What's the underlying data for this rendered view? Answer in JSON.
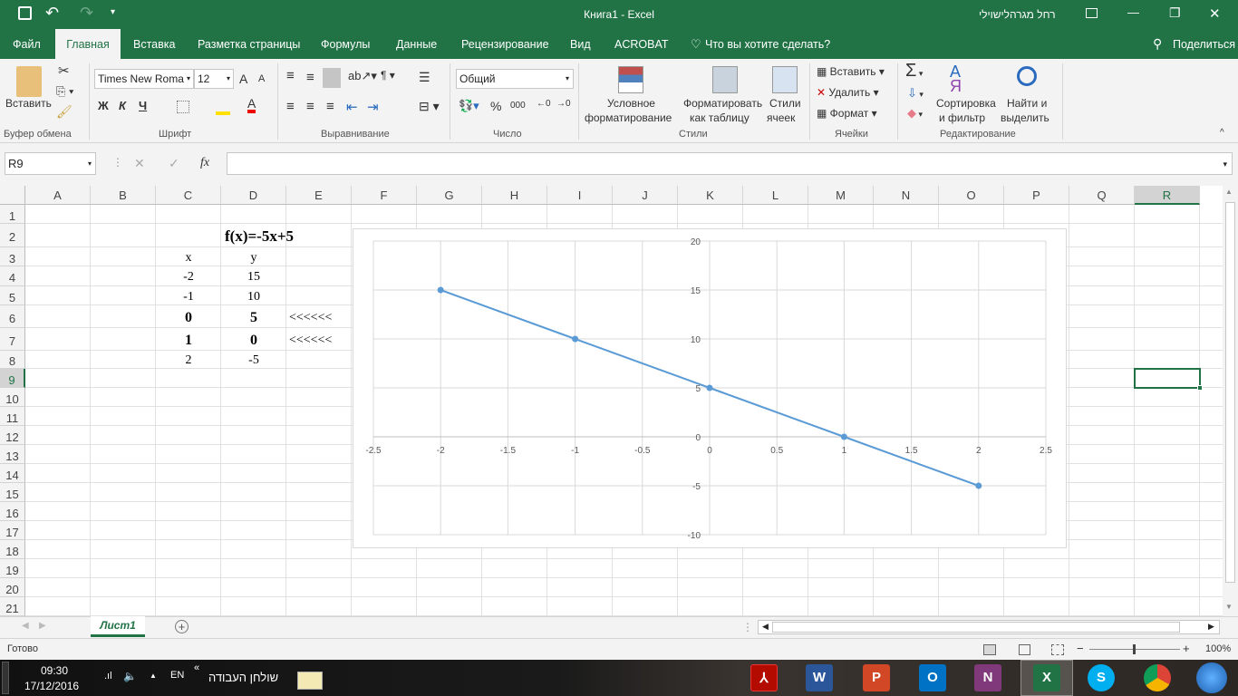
{
  "title_bar": {
    "title": "Книга1 - Excel",
    "user": "רחל מגרהלישוילי",
    "undo": "↶",
    "redo": "↷",
    "minimize": "—",
    "restore": "❐",
    "close": "✕"
  },
  "tabs": [
    {
      "label": "Файл"
    },
    {
      "label": "Главная"
    },
    {
      "label": "Вставка"
    },
    {
      "label": "Разметка страницы"
    },
    {
      "label": "Формулы"
    },
    {
      "label": "Данные"
    },
    {
      "label": "Рецензирование"
    },
    {
      "label": "Вид"
    },
    {
      "label": "ACROBAT"
    }
  ],
  "tell_me": "Что вы хотите сделать?",
  "share": "Поделиться",
  "ribbon": {
    "clipboard": {
      "paste": "Вставить",
      "label": "Буфер обмена"
    },
    "font": {
      "name": "Times New Roma",
      "size": "12",
      "bold": "Ж",
      "italic": "К",
      "underline": "Ч",
      "label": "Шрифт",
      "grow": "A",
      "shrink": "A",
      "fontcolor": "A"
    },
    "alignment": {
      "label": "Выравнивание"
    },
    "number": {
      "format": "Общий",
      "percent": "%",
      "thousands": "000",
      "label": "Число"
    },
    "styles": {
      "conditional1": "Условное",
      "conditional2": "форматирование",
      "table1": "Форматировать",
      "table2": "как таблицу",
      "cell1": "Стили",
      "cell2": "ячеек",
      "label": "Стили"
    },
    "cells": {
      "insert": "Вставить",
      "delete": "Удалить",
      "format": "Формат",
      "label": "Ячейки"
    },
    "editing": {
      "sort1": "Сортировка",
      "sort2": "и фильтр",
      "find1": "Найти и",
      "find2": "выделить",
      "label": "Редактирование"
    }
  },
  "formula_bar": {
    "name_box": "R9",
    "fx": "fx",
    "value": ""
  },
  "columns": [
    "A",
    "B",
    "C",
    "D",
    "E",
    "F",
    "G",
    "H",
    "I",
    "J",
    "K",
    "L",
    "M",
    "N",
    "O",
    "P",
    "Q",
    "R"
  ],
  "rows": [
    "1",
    "2",
    "3",
    "4",
    "5",
    "6",
    "7",
    "8",
    "9",
    "10",
    "11",
    "12",
    "13",
    "14",
    "15",
    "16",
    "17",
    "18",
    "19",
    "20",
    "21"
  ],
  "cells": {
    "D2": "f(x)=-5x+5",
    "C3": "x",
    "D3": "y",
    "C4": "-2",
    "D4": "15",
    "C5": "-1",
    "D5": "10",
    "C6": "0",
    "D6": "5",
    "E6": "<<<<<<",
    "C7": "1",
    "D7": "0",
    "E7": "<<<<<<",
    "C8": "2",
    "D8": "-5"
  },
  "chart_data": {
    "type": "scatter",
    "title": "",
    "xlabel": "",
    "ylabel": "",
    "series": [
      {
        "name": "y",
        "x": [
          -2,
          -1,
          0,
          1,
          2
        ],
        "y": [
          15,
          10,
          5,
          0,
          -5
        ],
        "color": "#5b9bd5",
        "lines": true
      }
    ],
    "xlim": [
      -2.5,
      2.5
    ],
    "ylim": [
      -10,
      20
    ],
    "xticks": [
      "-2.5",
      "-2",
      "-1.5",
      "-1",
      "-0.5",
      "0",
      "0.5",
      "1",
      "1.5",
      "2",
      "2.5"
    ],
    "yticks": [
      "20",
      "15",
      "10",
      "5",
      "0",
      "-5",
      "-10"
    ],
    "grid": true,
    "legend": "none"
  },
  "sheet_tabs": [
    {
      "label": "Лист1",
      "active": true
    }
  ],
  "status": {
    "ready": "Готово",
    "zoom": "100%"
  },
  "taskbar": {
    "time": "09:30",
    "date": "17/12/2016",
    "lang": "EN",
    "desktop": "שולחן העבודה",
    "chevron": "«"
  },
  "colors": {
    "excel_green": "#217346",
    "series": "#5b9bd5"
  }
}
